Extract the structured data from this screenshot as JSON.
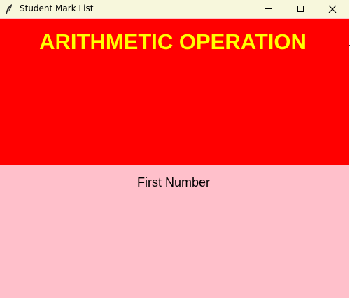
{
  "window": {
    "title": "Student Mark List",
    "controls": {
      "minimize_icon": "minimize-icon",
      "maximize_icon": "maximize-icon",
      "close_icon": "close-icon"
    }
  },
  "header": {
    "title": "ARITHMETIC OPERATION"
  },
  "form": {
    "first_label": "First Number"
  },
  "colors": {
    "titlebar_bg": "#f7f7dc",
    "header_bg": "#ff0000",
    "header_text": "#ffff00",
    "body_bg": "#ffc0cb",
    "label_text": "#000000"
  }
}
